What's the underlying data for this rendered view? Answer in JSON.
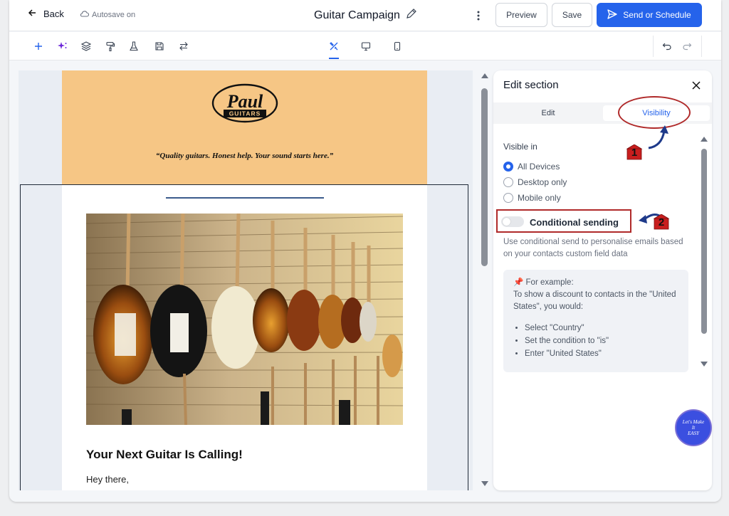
{
  "topbar": {
    "back_label": "Back",
    "autosave_label": "Autosave on",
    "campaign_title": "Guitar Campaign",
    "preview_label": "Preview",
    "save_label": "Save",
    "send_label": "Send or Schedule"
  },
  "email": {
    "logo_name": "Paul",
    "logo_sub": "GUITARS",
    "tagline": "“Quality guitars. Honest help. Your sound starts here.”",
    "headline": "Your Next Guitar Is Calling!",
    "greeting": "Hey there,"
  },
  "panel": {
    "title": "Edit section",
    "tabs": [
      {
        "label": "Edit"
      },
      {
        "label": "Visibility",
        "active": true
      }
    ],
    "visible_in_label": "Visible in",
    "visibility_options": [
      {
        "label": "All Devices",
        "selected": true
      },
      {
        "label": "Desktop only",
        "selected": false
      },
      {
        "label": "Mobile only",
        "selected": false
      }
    ],
    "conditional_label": "Conditional sending",
    "conditional_enabled": false,
    "conditional_desc": "Use conditional send to personalise emails based on your contacts custom field data",
    "example_title": "For example:",
    "example_intro": "To show a discount to contacts in the \"United States\", you would:",
    "example_steps": [
      "Select \"Country\"",
      "Set the condition to \"is\"",
      "Enter \"United States\""
    ]
  },
  "annotations": {
    "marker_1": "1",
    "marker_2": "2"
  },
  "badge": {
    "line1": "Let's Make",
    "line2": "It",
    "line3": "EASY"
  },
  "colors": {
    "accent": "#2563eb",
    "header_bg": "#f6c685",
    "highlight_red": "#b02a2a",
    "arrow_navy": "#1e3a8a"
  }
}
